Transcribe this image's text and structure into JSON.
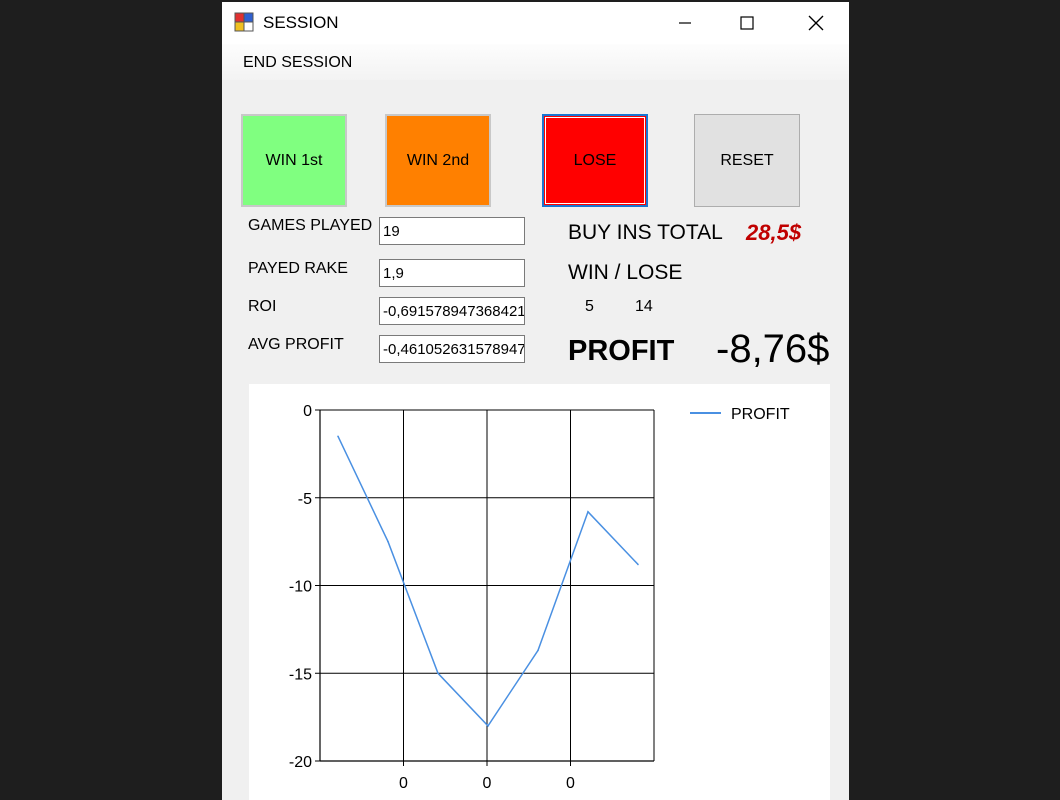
{
  "window": {
    "title": "SESSION"
  },
  "menu": {
    "end_session": "END SESSION"
  },
  "buttons": {
    "win1": "WIN 1st",
    "win2": "WIN 2nd",
    "lose": "LOSE",
    "reset": "RESET"
  },
  "stats": {
    "games_played_label": "GAMES PLAYED",
    "games_played": "19",
    "payed_rake_label": "PAYED RAKE",
    "payed_rake": "1,9",
    "roi_label": "ROI",
    "roi": "-0,691578947368421",
    "avg_profit_label": "AVG PROFIT",
    "avg_profit": "-0,461052631578947"
  },
  "summary": {
    "buy_ins_label": "BUY INS TOTAL",
    "buy_ins_value": "28,5$",
    "win_lose_label": "WIN / LOSE",
    "wins": "5",
    "losses": "14",
    "profit_label": "PROFIT",
    "profit_value": "-8,76$"
  },
  "colors": {
    "win1": "#80ff80",
    "win2": "#ff8000",
    "lose": "#ff0000",
    "buy_ins_value": "#c00000",
    "series": "#4a90e2"
  },
  "chart_data": {
    "type": "line",
    "x_tick_labels": [
      "0",
      "0",
      "0"
    ],
    "ylim": [
      -20,
      0
    ],
    "y_ticks": [
      0,
      -5,
      -10,
      -15,
      -20
    ],
    "grid": true,
    "legend_position": "top-right",
    "series": [
      {
        "name": "PROFIT",
        "values": [
          -1.5,
          -7.5,
          -15.0,
          -18.0,
          -13.7,
          -5.8,
          -8.8
        ]
      }
    ]
  }
}
